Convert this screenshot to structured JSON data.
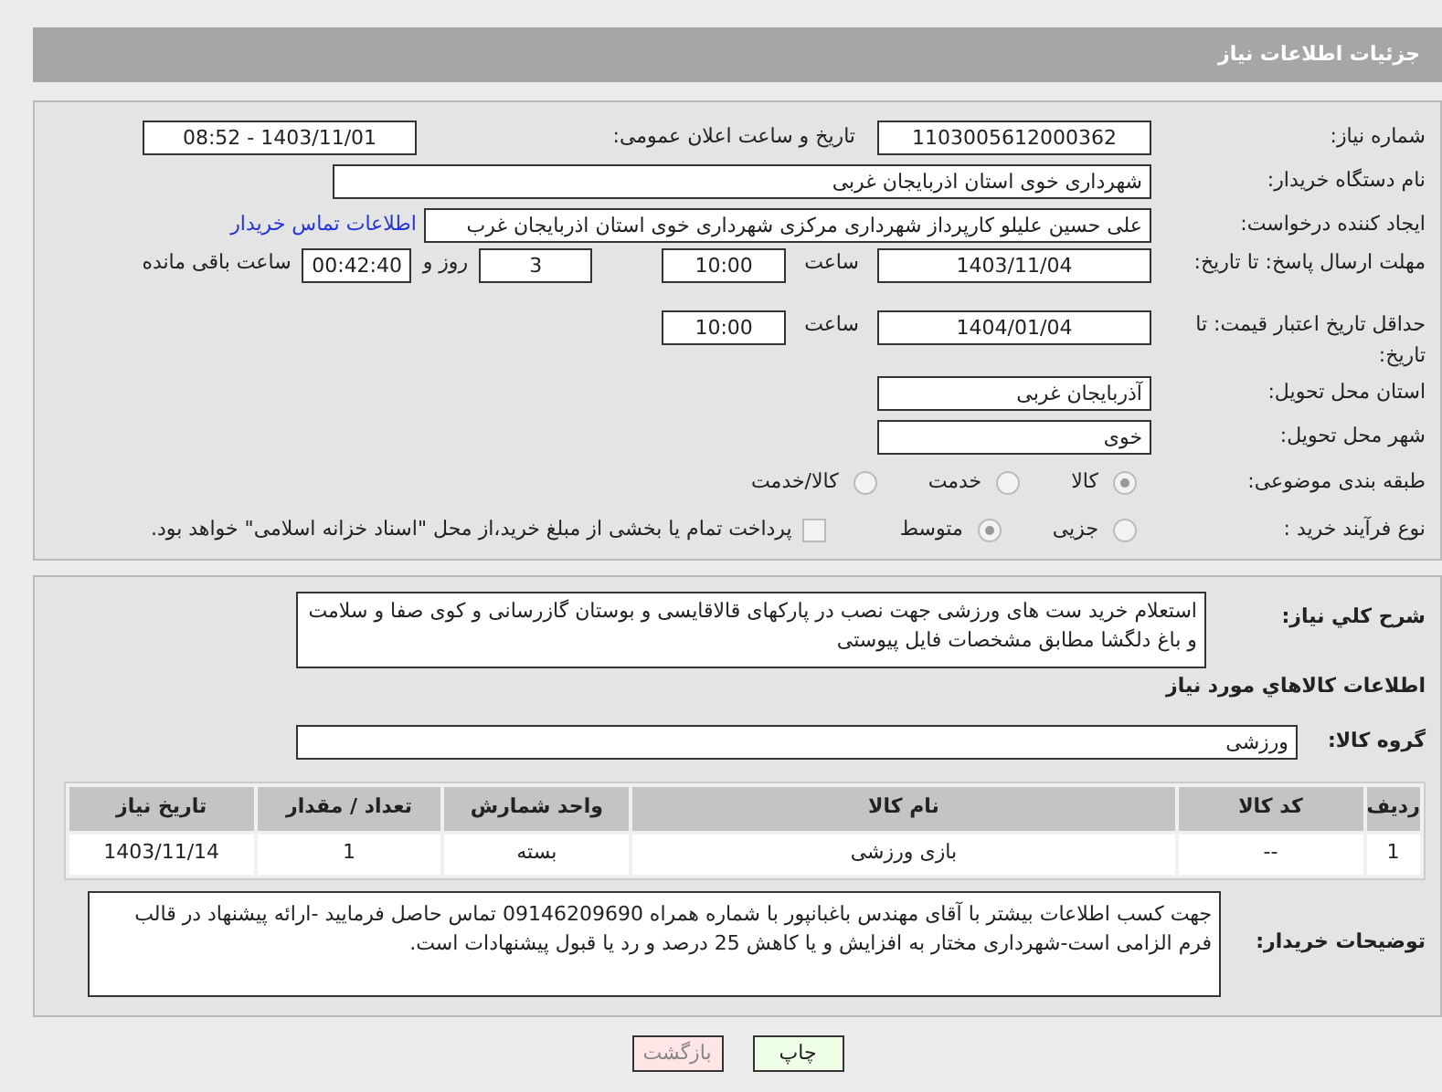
{
  "header": {
    "title": "جزئیات اطلاعات نیاز"
  },
  "need_number": {
    "label": "شماره نیاز:",
    "value": "1103005612000362"
  },
  "announce": {
    "label": "تاریخ و ساعت اعلان عمومی:",
    "value": "1403/11/01 - 08:52"
  },
  "buyer_org": {
    "label": "نام دستگاه خریدار:",
    "value": "شهرداری خوی استان اذربایجان غربی"
  },
  "requester": {
    "label": "ایجاد کننده درخواست:",
    "value": "علی حسین علیلو کارپرداز شهرداری مرکزی شهرداری خوی استان اذربایجان غرب",
    "link": "اطلاعات تماس خریدار"
  },
  "response_deadline": {
    "label": "مهلت ارسال پاسخ: تا تاریخ:",
    "date": "1403/11/04",
    "time_label": "ساعت",
    "time": "10:00",
    "days": "3",
    "days_label": "روز و",
    "remaining": "00:42:40",
    "remaining_label": "ساعت باقی مانده"
  },
  "price_validity": {
    "label": "حداقل تاریخ اعتبار قیمت: تا تاریخ:",
    "date": "1404/01/04",
    "time_label": "ساعت",
    "time": "10:00"
  },
  "province": {
    "label": "استان محل تحویل:",
    "value": "آذربایجان غربی"
  },
  "city": {
    "label": "شهر محل تحویل:",
    "value": "خوی"
  },
  "category": {
    "label": "طبقه بندی موضوعی:",
    "options": [
      {
        "label": "کالا",
        "selected": true
      },
      {
        "label": "خدمت",
        "selected": false
      },
      {
        "label": "کالا/خدمت",
        "selected": false
      }
    ]
  },
  "process": {
    "label": "نوع فرآیند خرید :",
    "options": [
      {
        "label": "جزیی",
        "selected": false
      },
      {
        "label": "متوسط",
        "selected": true
      }
    ],
    "payment": {
      "label": "پرداخت تمام یا بخشی از مبلغ خرید،از محل \"اسناد خزانه اسلامی\" خواهد بود.",
      "checked": false
    }
  },
  "description": {
    "label": "شرح کلي نیاز:",
    "text": "استعلام خرید ست های ورزشی جهت نصب در پارکهای قالاقایسی و بوستان گازرسانی و کوی صفا و سلامت و باغ دلگشا مطابق مشخصات فایل پیوستی"
  },
  "goods_title": "اطلاعات کالاهاي مورد نیاز",
  "goods_group": {
    "label": "گروه کالا:",
    "value": "ورزشی"
  },
  "table": {
    "columns": [
      "ردیف",
      "کد کالا",
      "نام کالا",
      "واحد شمارش",
      "تعداد / مقدار",
      "تاریخ نیاز"
    ],
    "rows": [
      [
        "1",
        "--",
        "بازی ورزشی",
        "بسته",
        "1",
        "1403/11/14"
      ]
    ]
  },
  "buyer_notes": {
    "label": "توضیحات خریدار:",
    "text": "جهت کسب اطلاعات بیشتر با آقای مهندس باغبانپور با شماره همراه 09146209690 تماس حاصل فرمایید -ارائه پیشنهاد در قالب فرم الزامی است-شهرداری مختار به افزایش و یا کاهش 25 درصد و رد یا قبول پیشنهادات است."
  },
  "buttons": [
    {
      "label": "چاپ",
      "kind": "print"
    },
    {
      "label": "بازگشت",
      "kind": "back"
    }
  ]
}
